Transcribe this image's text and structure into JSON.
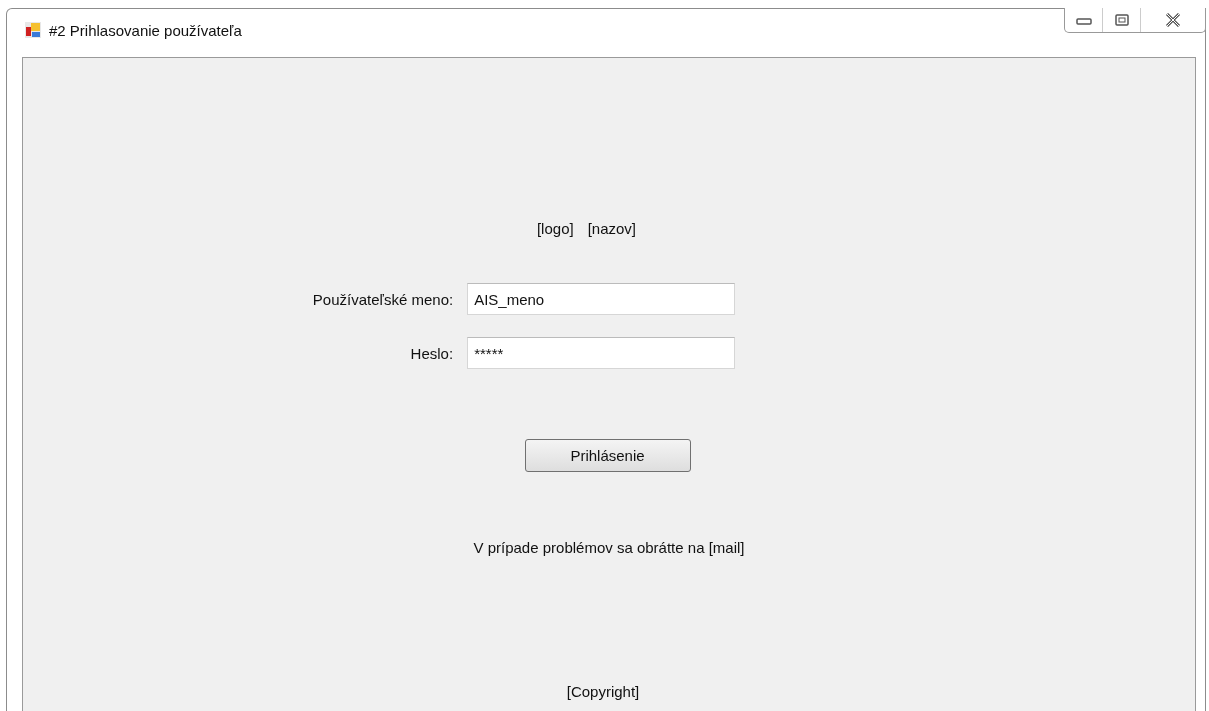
{
  "window": {
    "title": "#2 Prihlasovanie používateľa"
  },
  "header": {
    "logo": "[logo]",
    "name": "[nazov]"
  },
  "fields": [
    {
      "label": "Používateľské meno:",
      "value": "AIS_meno"
    },
    {
      "label": "Heslo:",
      "value": "*****"
    }
  ],
  "login_button": "Prihlásenie",
  "help_text": "V prípade problémov sa obrátte na [mail]",
  "footer": "[Copyright]"
}
